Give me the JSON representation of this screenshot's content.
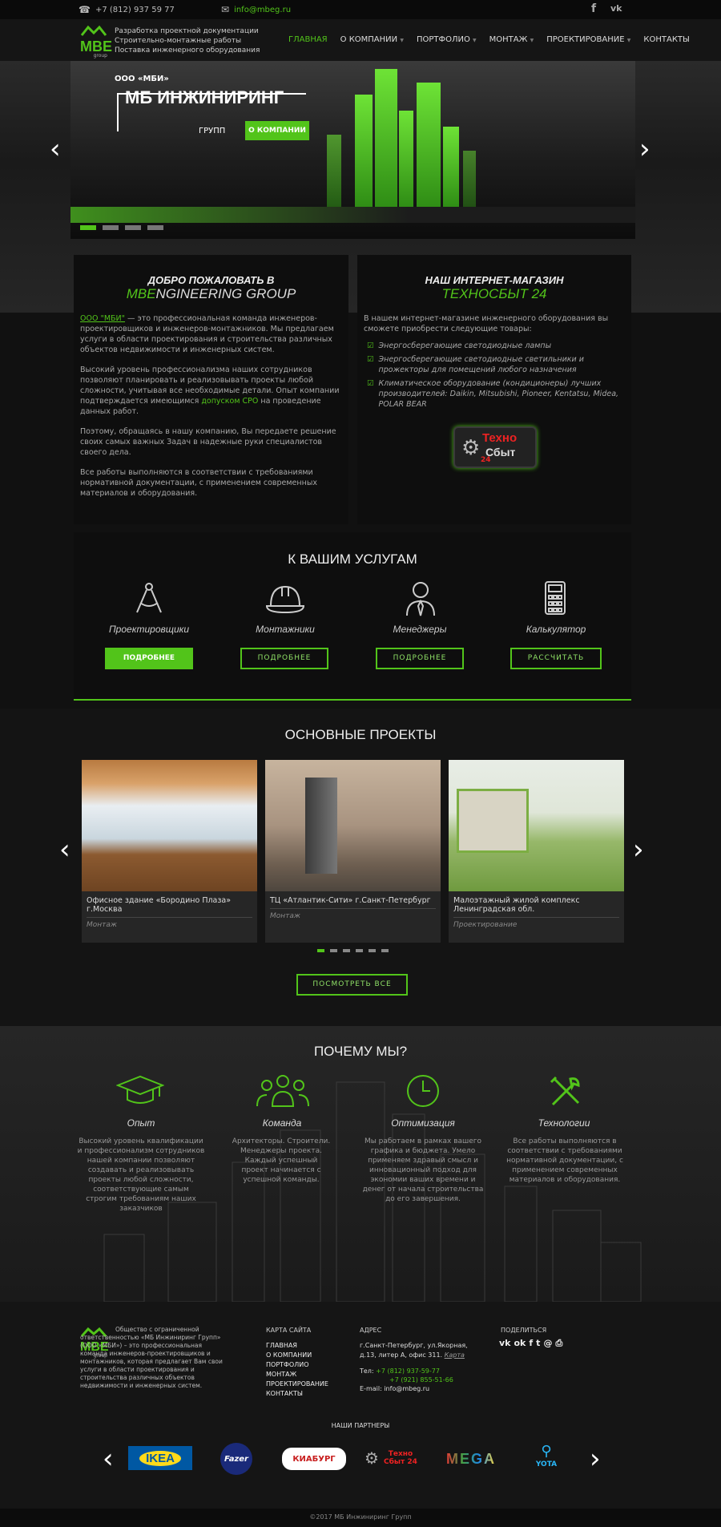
{
  "topbar": {
    "phone": "+7 (812) 937 59 77",
    "email": "info@mbeg.ru",
    "social": [
      "facebook-icon",
      "vk-icon"
    ]
  },
  "header": {
    "logo": "MBE",
    "logo_sub": "group",
    "tagline": [
      "Разработка проектной документации",
      "Строительно-монтажные работы",
      "Поставка инженерного оборудования"
    ],
    "nav": [
      {
        "label": "ГЛАВНАЯ",
        "active": true
      },
      {
        "label": "О КОМПАНИИ",
        "dropdown": true
      },
      {
        "label": "ПОРТФОЛИО",
        "dropdown": true
      },
      {
        "label": "МОНТАЖ",
        "dropdown": true
      },
      {
        "label": "ПРОЕКТИРОВАНИЕ",
        "dropdown": true
      },
      {
        "label": "КОНТАКТЫ"
      }
    ]
  },
  "hero": {
    "pretitle": "ООО «МБИ»",
    "title": "МБ ИНЖИНИРИНГ",
    "subtitle": "ГРУПП",
    "button": "О КОМПАНИИ",
    "slides": 4,
    "active_slide": 0
  },
  "welcome": {
    "title": "ДОБРО ПОЖАЛОВАТЬ В",
    "title2_green": "MBE",
    "title2_rest": "NGINEERING GROUP",
    "p1_link": "ООО \"МБИ\"",
    "p1": " — это профессиональная команда инженеров-проектировщиков и инженеров-монтажников. Мы предлагаем услуги в области проектирования и строительства различных объектов недвижимости и инженерных систем.",
    "p2a": "Высокий уровень профессионализма наших сотрудников позволяют планировать и реализовывать проекты любой сложности, учитывая все необходимые детали. Опыт компании подтверждается имеющимся ",
    "p2_link": "допуском СРО",
    "p2b": " на проведение данных работ.",
    "p3": "Поэтому, обращаясь в нашу компанию, Вы передаете решение своих самых важных Задач в надежные руки специалистов своего дела.",
    "p4": "Все работы выполняются в соответствии с требованиями нормативной документации, с применением современных материалов и оборудования."
  },
  "shop": {
    "title": "НАШ ИНТЕРНЕТ-МАГАЗИН",
    "title2": "ТЕХНОСБЫТ 24",
    "intro": "В нашем интернет-магазине инженерного оборудования вы сможете приобрести следующие товары:",
    "items": [
      "Энергосберегающие светодиодные лампы",
      "Энергосберегающие светодиодные светильники и прожекторы для помещений любого назначения",
      "Климатическое оборудование (кондиционеры) лучших производителей: Daikin, Mitsubishi, Pioneer, Kentatsu, Midea, POLAR BEAR"
    ],
    "logo_top": "Техно",
    "logo_mid": "Сбыт",
    "logo_num": "24"
  },
  "services": {
    "title": "К ВАШИМ УСЛУГАМ",
    "items": [
      {
        "icon": "compass-icon",
        "name": "Проектировщики",
        "button": "ПОДРОБНЕЕ",
        "filled": true
      },
      {
        "icon": "hardhat-icon",
        "name": "Монтажники",
        "button": "ПОДРОБНЕЕ",
        "filled": false
      },
      {
        "icon": "manager-icon",
        "name": "Менеджеры",
        "button": "ПОДРОБНЕЕ",
        "filled": false
      },
      {
        "icon": "calculator-icon",
        "name": "Калькулятор",
        "button": "РАССЧИТАТЬ",
        "filled": false
      }
    ]
  },
  "projects": {
    "title": "ОСНОВНЫЕ ПРОЕКТЫ",
    "items": [
      {
        "title": "Офисное здание «Бородино Плаза» г.Москва",
        "category": "Монтаж"
      },
      {
        "title": "ТЦ «Атлантик-Сити» г.Санкт-Петербург",
        "category": "Монтаж"
      },
      {
        "title": "Малоэтажный жилой комплекс Ленинградская обл.",
        "category": "Проектирование"
      }
    ],
    "dots": 6,
    "active_dot": 0,
    "button": "ПОСМОТРЕТЬ ВСЕ"
  },
  "why": {
    "title": "ПОЧЕМУ МЫ?",
    "items": [
      {
        "icon": "graduation-cap-icon",
        "name": "Опыт",
        "text": "Высокий уровень квалификации и профессионализм сотрудников нашей компании позволяют создавать и реализовывать проекты любой сложности, соответствующие самым строгим требованиям наших заказчиков"
      },
      {
        "icon": "team-icon",
        "name": "Команда",
        "text": "Архитекторы. Строители. Менеджеры проекта. Каждый успешный проект начинается с успешной команды."
      },
      {
        "icon": "clock-icon",
        "name": "Оптимизация",
        "text": "Мы работаем в рамках вашего графика и бюджета. Умело применяем здравый смысл и инновационный подход для экономии ваших времени и денег от начала строительства до его завершения."
      },
      {
        "icon": "tools-icon",
        "name": "Технологии",
        "text": "Все работы выполняются в соответствии с требованиями нормативной документации, с применением современных материалов и оборудования."
      }
    ]
  },
  "footer": {
    "about": "Общество с ограниченной ответственностью «МБ Инжиниринг Групп» (ООО «МБИ») – это профессиональная команда инженеров-проектировщиков и монтажников, которая предлагает Вам свои услуги в области проектирования и строительства различных объектов недвижимости и инженерных систем.",
    "sitemap_title": "КАРТА САЙТА",
    "sitemap": [
      "ГЛАВНАЯ",
      "О КОМПАНИИ",
      "ПОРТФОЛИО",
      "МОНТАЖ",
      "ПРОЕКТИРОВАНИЕ",
      "КОНТАКТЫ"
    ],
    "address_title": "АДРЕС",
    "address": "г.Санкт-Петербург, ул.Якорная, д.13, литер А, офис 311.",
    "map_link": "Карта",
    "tel_label": "Тел:",
    "tel1": "+7 (812) 937-59-77",
    "tel2": "+7 (921) 855-51-66",
    "email_label": "E-mail:",
    "email": "info@mbeg.ru",
    "share_title": "ПОДЕЛИТЬСЯ",
    "share_icons": [
      "vk-icon",
      "ok-icon",
      "facebook-icon",
      "twitter-icon",
      "mail-icon",
      "print-icon"
    ],
    "partners_title": "НАШИ ПАРТНЕРЫ",
    "partners": [
      "IKEA",
      "Fazer",
      "КИАБУРГ",
      "Техно Сбыт 24",
      "MEGA",
      "YOTA"
    ],
    "copyright": "©2017  МБ Инжиниринг Групп"
  },
  "colors": {
    "accent": "#52c41a",
    "bg": "#111111"
  }
}
